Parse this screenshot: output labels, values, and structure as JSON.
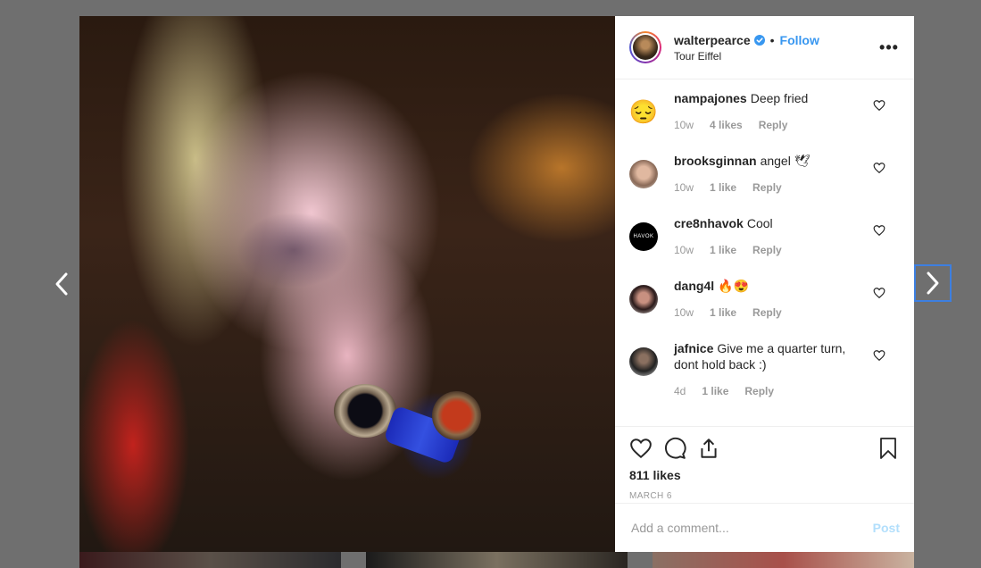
{
  "post": {
    "username": "walterpearce",
    "separator": "•",
    "follow_label": "Follow",
    "location": "Tour Eiffel",
    "more_label": "•••",
    "likes_text": "811 likes",
    "date": "MARCH 6"
  },
  "comments": [
    {
      "user": "nampajones",
      "text": "Deep fried",
      "time": "10w",
      "likes": "4 likes",
      "reply": "Reply",
      "avatar": "😔"
    },
    {
      "user": "brooksginnan",
      "text": "angel 🕊",
      "time": "10w",
      "likes": "1 like",
      "reply": "Reply",
      "avatar": ""
    },
    {
      "user": "cre8nhavok",
      "text": "Cool",
      "time": "10w",
      "likes": "1 like",
      "reply": "Reply",
      "avatar": "HAVOK"
    },
    {
      "user": "dang4l",
      "text": "🔥😍",
      "time": "10w",
      "likes": "1 like",
      "reply": "Reply",
      "avatar": ""
    },
    {
      "user": "jafnice",
      "text": "Give me a quarter turn, dont hold back :)",
      "time": "4d",
      "likes": "1 like",
      "reply": "Reply",
      "avatar": ""
    }
  ],
  "composer": {
    "placeholder": "Add a comment...",
    "post_label": "Post"
  },
  "icons": {
    "prev": "chevron-left-icon",
    "next": "chevron-right-icon",
    "like": "heart-icon",
    "comment": "comment-icon",
    "share": "share-icon",
    "save": "bookmark-icon"
  },
  "colors": {
    "follow": "#3897f0",
    "post_disabled": "#b2dffc",
    "verified": "#3897f0",
    "focus_ring": "#3d7fe0"
  }
}
